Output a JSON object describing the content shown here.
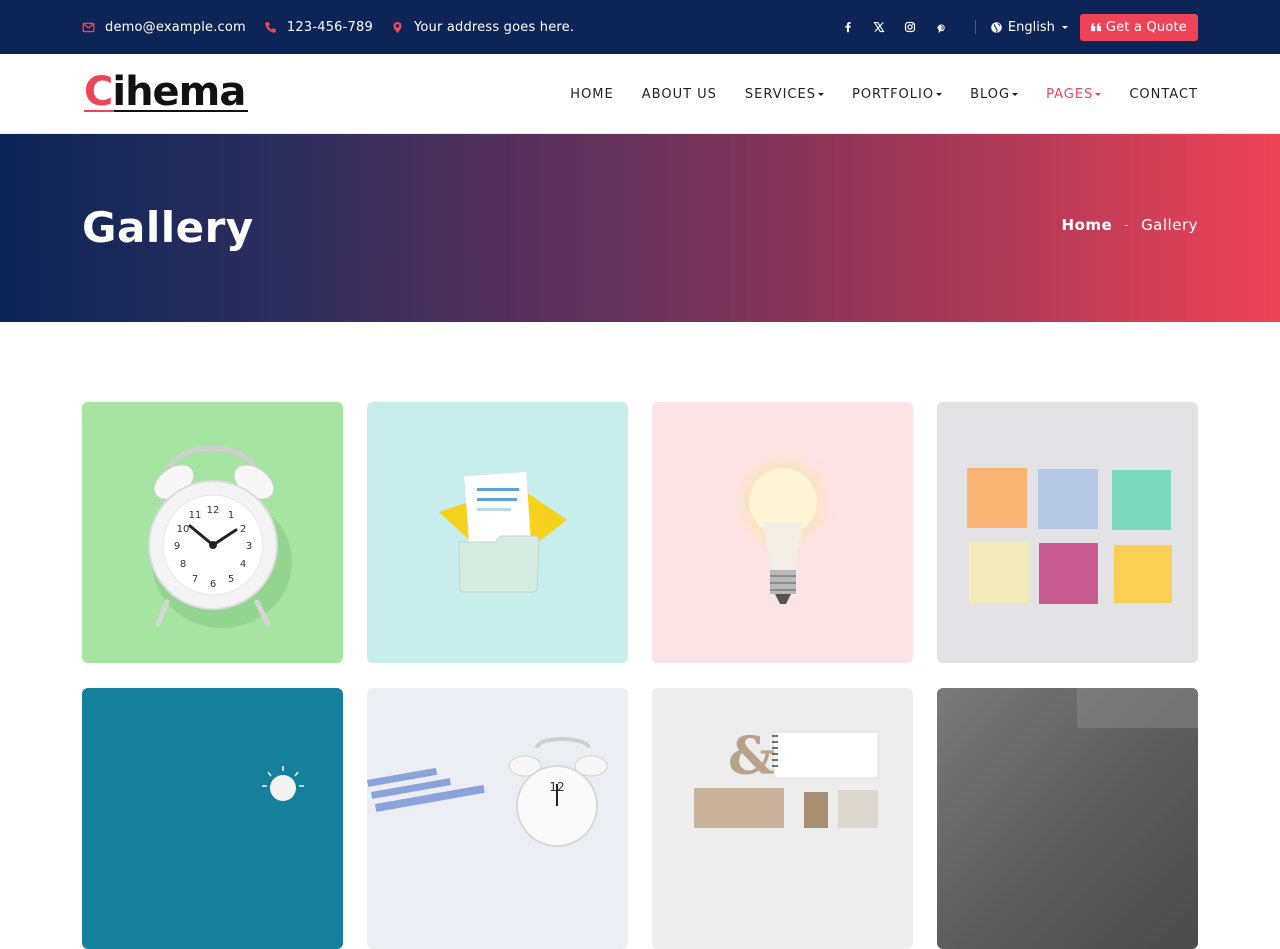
{
  "topbar": {
    "email": "demo@example.com",
    "phone": "123-456-789",
    "address": "Your address goes here.",
    "icons": [
      "envelope-icon",
      "phone-icon",
      "map-pin-icon"
    ],
    "social": [
      "facebook-icon",
      "x-icon",
      "instagram-icon",
      "pinterest-icon"
    ],
    "language": "English",
    "quote_button": "Get a Quote",
    "colors": {
      "bg": "#0d2456",
      "accent": "#ef4457"
    }
  },
  "header": {
    "logo_first": "C",
    "logo_rest": "ihema",
    "nav": [
      {
        "label": "HOME",
        "dropdown": false,
        "active": false
      },
      {
        "label": "ABOUT US",
        "dropdown": false,
        "active": false
      },
      {
        "label": "SERVICES",
        "dropdown": true,
        "active": false
      },
      {
        "label": "PORTFOLIO",
        "dropdown": true,
        "active": false
      },
      {
        "label": "BLOG",
        "dropdown": true,
        "active": false
      },
      {
        "label": "PAGES",
        "dropdown": true,
        "active": true
      },
      {
        "label": "CONTACT",
        "dropdown": false,
        "active": false
      }
    ]
  },
  "banner": {
    "title": "Gallery",
    "breadcrumb": {
      "home": "Home",
      "separator": "-",
      "current": "Gallery"
    }
  },
  "gallery": {
    "items": [
      {
        "subject": "alarm-clock-on-green",
        "bg": "#a6e4a1"
      },
      {
        "subject": "folder-and-documents-on-mint",
        "bg": "#c7eeec"
      },
      {
        "subject": "light-bulb-on-pink",
        "bg": "#fbe3e6"
      },
      {
        "subject": "sticky-notes-on-grey",
        "bg": "#e3e3e5"
      },
      {
        "subject": "bulb-on-teal",
        "bg": "#15809c"
      },
      {
        "subject": "clock-with-charts",
        "bg": "#eceef3"
      },
      {
        "subject": "stationery-ampersand",
        "bg": "#ededee"
      },
      {
        "subject": "grey-texture",
        "bg": "#6f6f6f"
      }
    ]
  }
}
